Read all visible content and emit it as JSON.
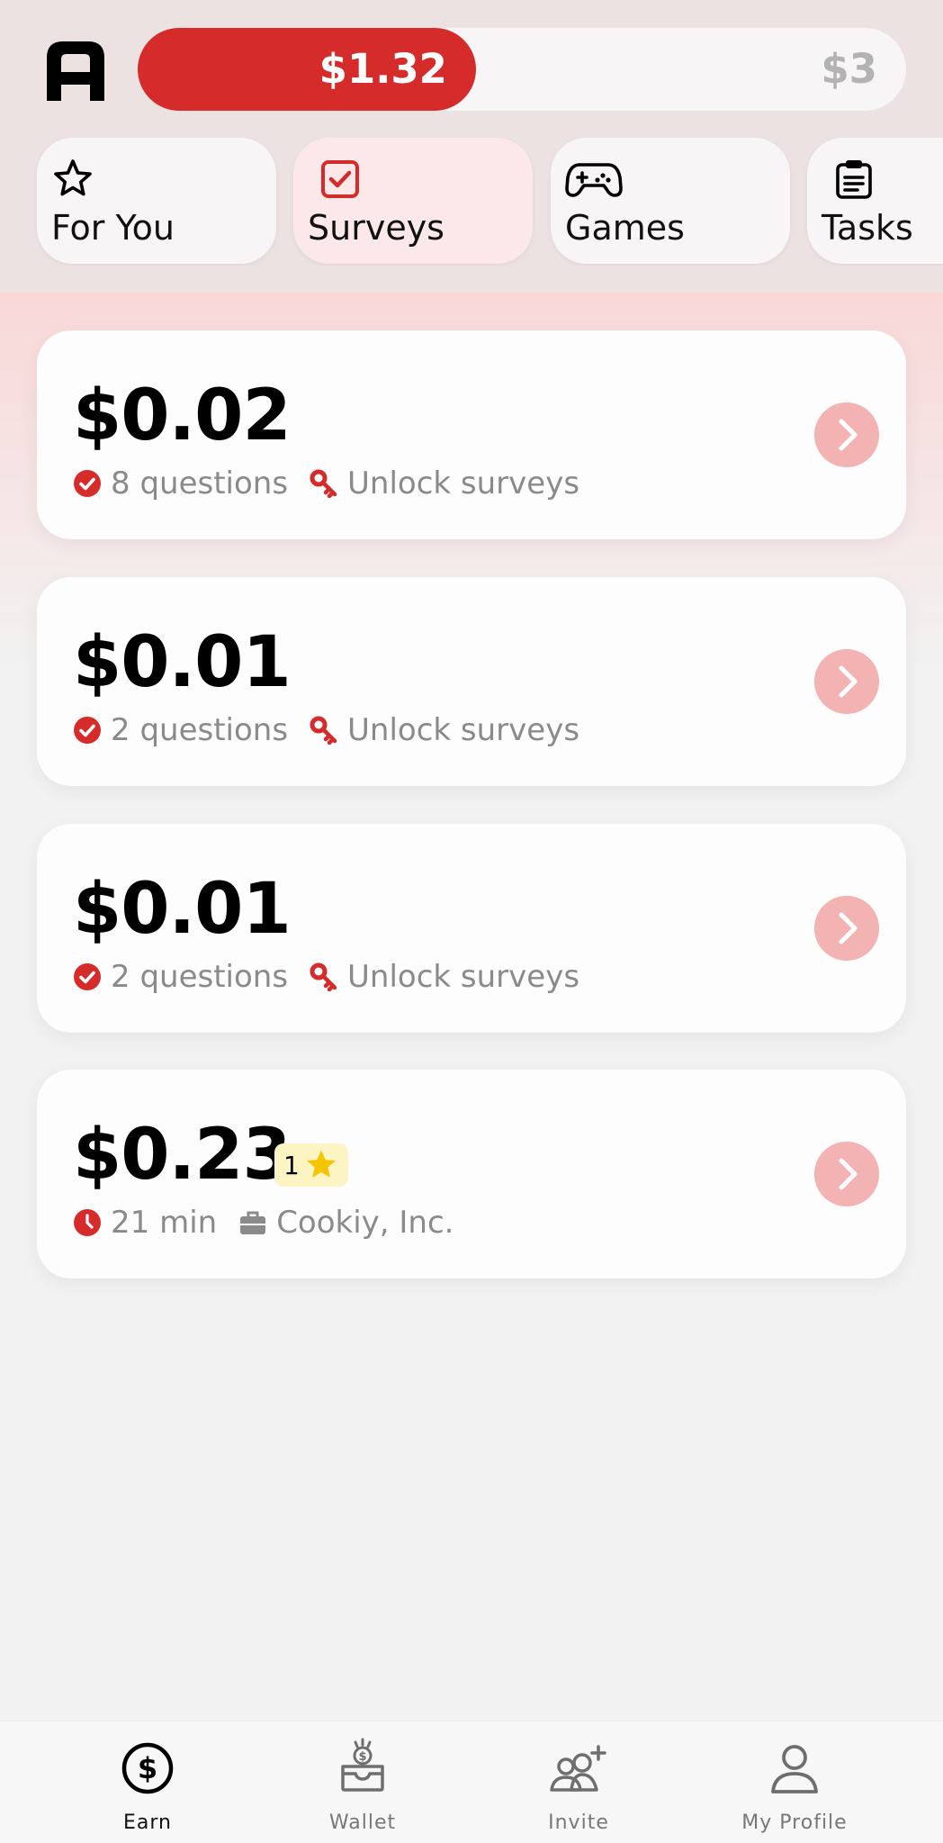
{
  "header": {
    "progress_current": "$1.32",
    "progress_goal": "$3",
    "progress_fraction": 0.44,
    "accent_color": "#d62b2b"
  },
  "tabs": [
    {
      "label": "For You",
      "icon": "star-icon",
      "active": false
    },
    {
      "label": "Surveys",
      "icon": "checkbox-icon",
      "active": true
    },
    {
      "label": "Games",
      "icon": "gamepad-icon",
      "active": false
    },
    {
      "label": "Tasks",
      "icon": "clipboard-icon",
      "active": false
    }
  ],
  "surveys": [
    {
      "amount": "$0.02",
      "meta1": "8 questions",
      "meta1_icon": "check-circle-icon",
      "meta2": "Unlock surveys",
      "meta2_icon": "key-icon"
    },
    {
      "amount": "$0.01",
      "meta1": "2 questions",
      "meta1_icon": "check-circle-icon",
      "meta2": "Unlock surveys",
      "meta2_icon": "key-icon"
    },
    {
      "amount": "$0.01",
      "meta1": "2 questions",
      "meta1_icon": "check-circle-icon",
      "meta2": "Unlock surveys",
      "meta2_icon": "key-icon"
    },
    {
      "amount": "$0.23",
      "badge": "1",
      "badge_icon": "star-icon",
      "meta1": "21 min",
      "meta1_icon": "clock-icon",
      "meta2": "Cookiy, Inc.",
      "meta2_icon": "briefcase-icon"
    }
  ],
  "bottom_nav": [
    {
      "label": "Earn",
      "icon": "dollar-circle-icon",
      "active": true
    },
    {
      "label": "Wallet",
      "icon": "wallet-icon",
      "active": false
    },
    {
      "label": "Invite",
      "icon": "add-friends-icon",
      "active": false
    },
    {
      "label": "My Profile",
      "icon": "user-icon",
      "active": false
    }
  ]
}
